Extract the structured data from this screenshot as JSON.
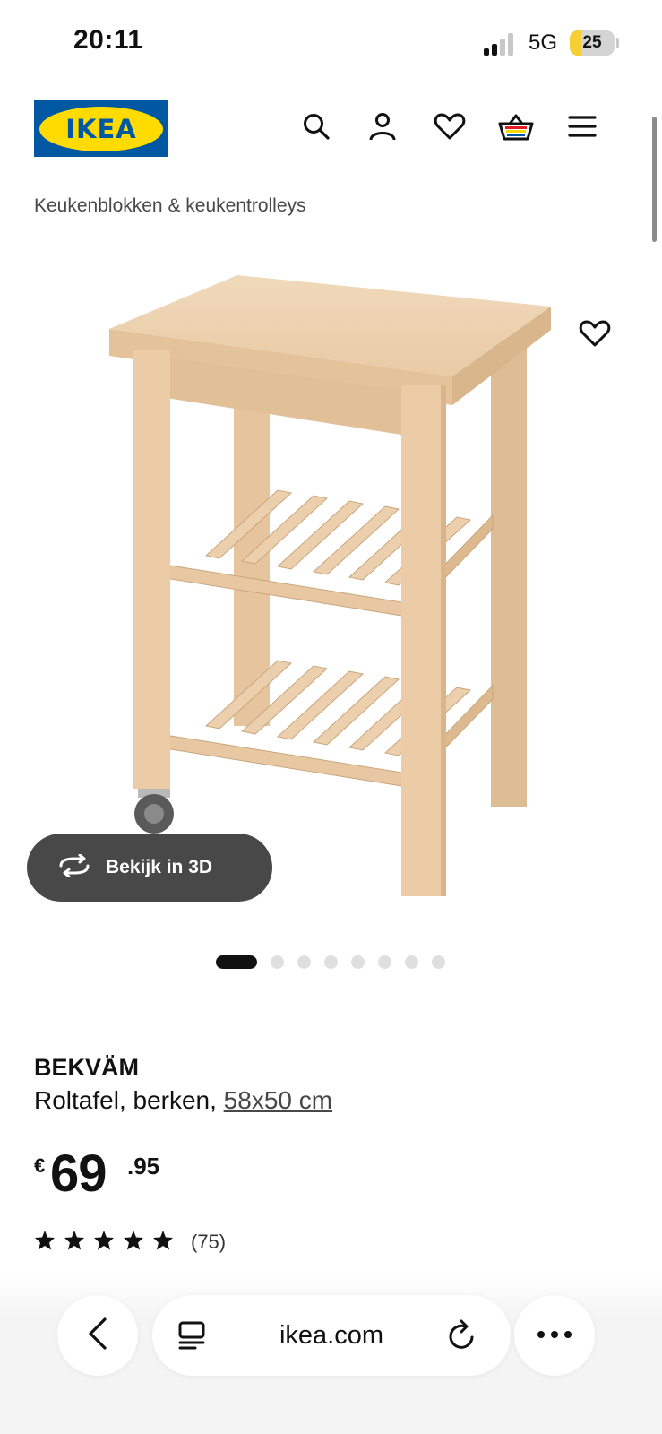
{
  "status_bar": {
    "time": "20:11",
    "network": "5G",
    "battery": "25",
    "battery_level": 0.25
  },
  "header": {
    "logo_text": "IKEA",
    "icons": [
      "search-icon",
      "account-icon",
      "heart-icon",
      "basket-icon",
      "menu-icon"
    ]
  },
  "breadcrumb": "Keukenblokken & keukentrolleys",
  "product": {
    "view_3d_label": "Bekijk in 3D",
    "carousel": {
      "total": 8,
      "active_index": 0
    },
    "name": "BEKVÄM",
    "description": "Roltafel, berken, ",
    "size": "58x50 cm",
    "price": {
      "currency": "€",
      "integer": "69",
      "decimal": ".95"
    },
    "rating": {
      "stars": 5,
      "count": "(75)"
    }
  },
  "browser": {
    "url": "ikea.com"
  },
  "colors": {
    "brand_blue": "#0058a3",
    "brand_yellow": "#ffdb00",
    "wood": "#e8c9a4"
  }
}
